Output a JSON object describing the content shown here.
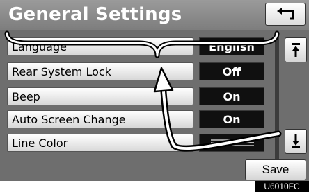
{
  "header": {
    "title": "General Settings"
  },
  "settings": [
    {
      "label": "Language",
      "value": "English"
    },
    {
      "label": "Rear System Lock",
      "value": "Off"
    },
    {
      "label": "Beep",
      "value": "On"
    },
    {
      "label": "Auto Screen Change",
      "value": "On"
    },
    {
      "label": "Line Color",
      "value": ""
    }
  ],
  "footer": {
    "save_label": "Save"
  },
  "figure_code": "U6010FC",
  "icons": {
    "back": "back-arrow-icon",
    "scroll_up": "scroll-up-icon",
    "scroll_down": "scroll-down-icon"
  },
  "colors": {
    "screen_bg": "#6e6e6e",
    "value_bg": "#101010",
    "button_bg": "#ffffff"
  }
}
